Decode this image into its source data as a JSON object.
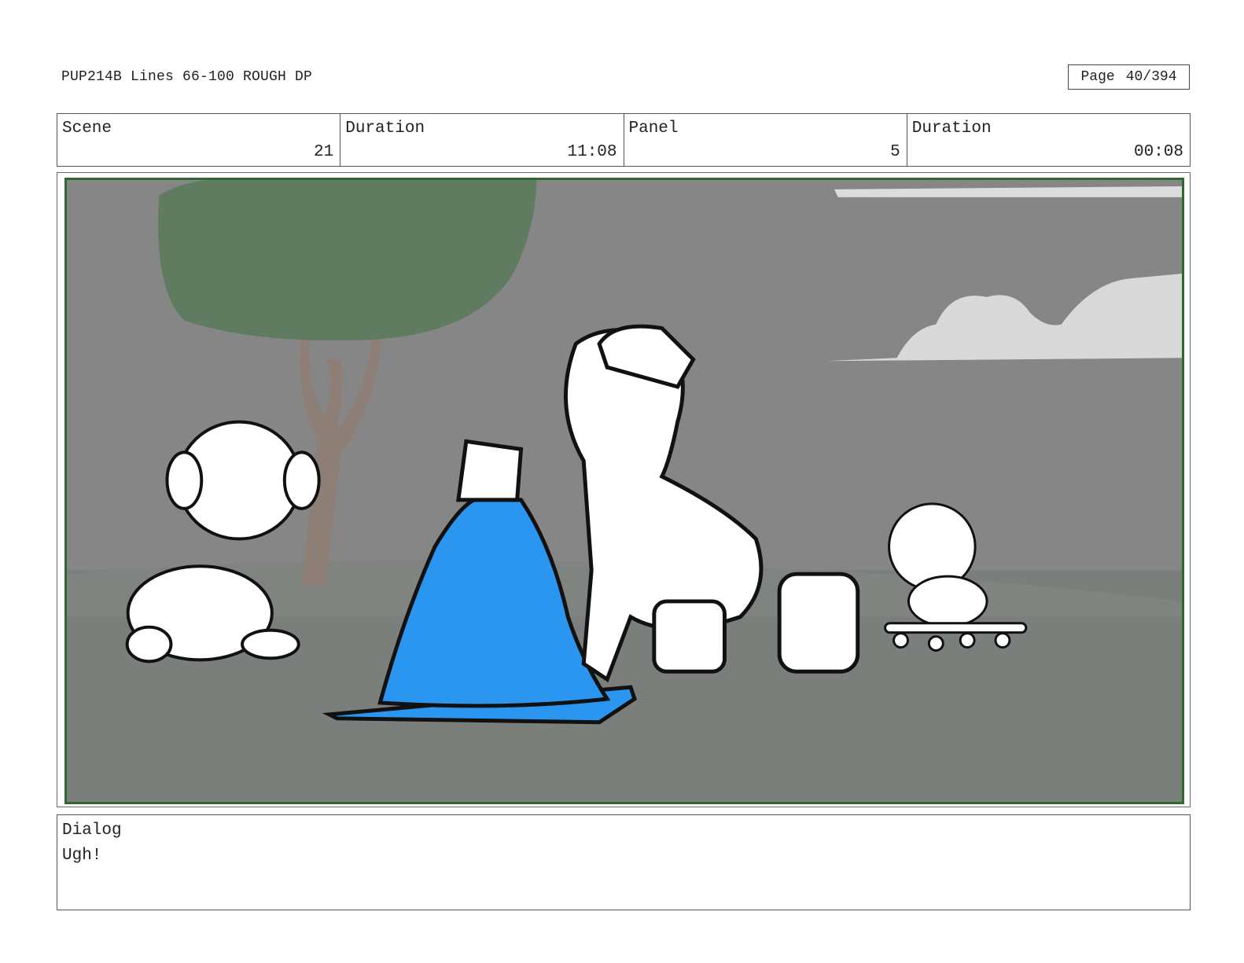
{
  "header": {
    "title": "PUP214B Lines 66-100 ROUGH DP",
    "page_label": "Page",
    "page_value": "40/394"
  },
  "info": {
    "scene_label": "Scene",
    "scene_value": "21",
    "scene_duration_label": "Duration",
    "scene_duration_value": "11:08",
    "panel_label": "Panel",
    "panel_value": "5",
    "panel_duration_label": "Duration",
    "panel_duration_value": "00:08"
  },
  "dialog": {
    "label": "Dialog",
    "text": "Ugh!"
  },
  "colors": {
    "frame_border": "#2e6a2e",
    "background_gray": "#858585",
    "ground_gray": "#7c807c",
    "cone_blue": "#2a96f0",
    "tree_green": "#5f7a5f",
    "cloud": "#d9d9d9"
  }
}
